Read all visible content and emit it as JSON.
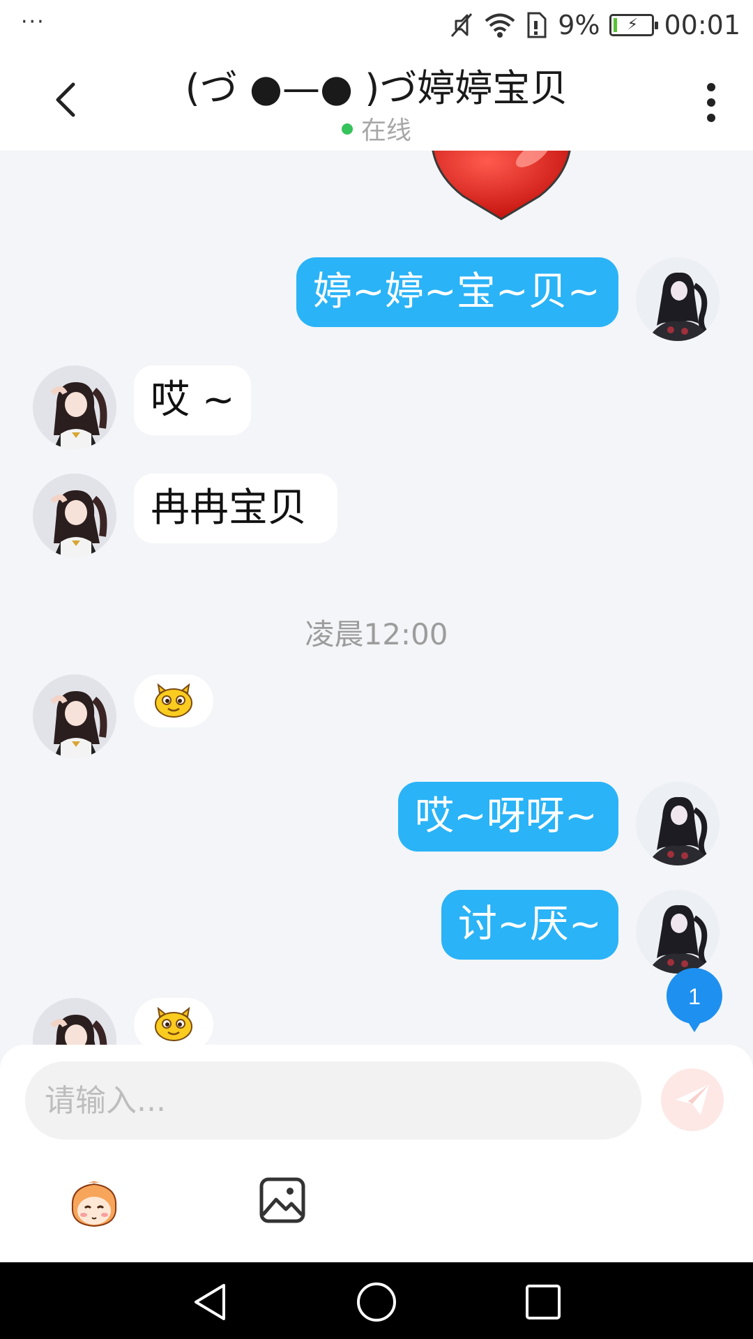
{
  "status_bar": {
    "dots": "···",
    "battery_percent": "9%",
    "battery_level": 0.09,
    "time": "00:01",
    "icons": [
      "mute-icon",
      "wifi-icon",
      "sim-icon",
      "battery-charging-icon"
    ]
  },
  "header": {
    "title": "(づ ●—● )づ婷婷宝贝",
    "status": "在线",
    "icons": [
      "back-arrow-icon",
      "more-vertical-icon"
    ]
  },
  "messages": [
    {
      "direction": "incoming",
      "kind": "sticker",
      "content": "heart-sticker"
    },
    {
      "direction": "outgoing",
      "kind": "text",
      "text": "婷~婷~宝~贝~"
    },
    {
      "direction": "incoming",
      "kind": "text",
      "text": "哎 ~"
    },
    {
      "direction": "incoming",
      "kind": "text",
      "text": "冉冉宝贝"
    },
    {
      "direction": "incoming",
      "kind": "emoji",
      "content": "yellow-face-emoji"
    },
    {
      "direction": "outgoing",
      "kind": "text",
      "text": "哎~呀呀~"
    },
    {
      "direction": "outgoing",
      "kind": "text",
      "text": "讨~厌~"
    },
    {
      "direction": "incoming",
      "kind": "emoji",
      "content": "yellow-face-emoji"
    }
  ],
  "timestamp": "凌晨12:00",
  "unread_badge": "1",
  "composer": {
    "placeholder": "请输入...",
    "value": ""
  },
  "toolbar_icons": [
    "emoji-face-icon",
    "image-icon",
    "send-icon"
  ],
  "nav_icons": [
    "nav-back-icon",
    "nav-home-icon",
    "nav-recents-icon"
  ],
  "colors": {
    "outgoing_bubble": "#2ab3f7",
    "incoming_bubble": "#ffffff",
    "chat_background": "#f3f5f8",
    "online_dot": "#35c35b",
    "send_button": "#fde8e5",
    "badge": "#1e90f0"
  }
}
